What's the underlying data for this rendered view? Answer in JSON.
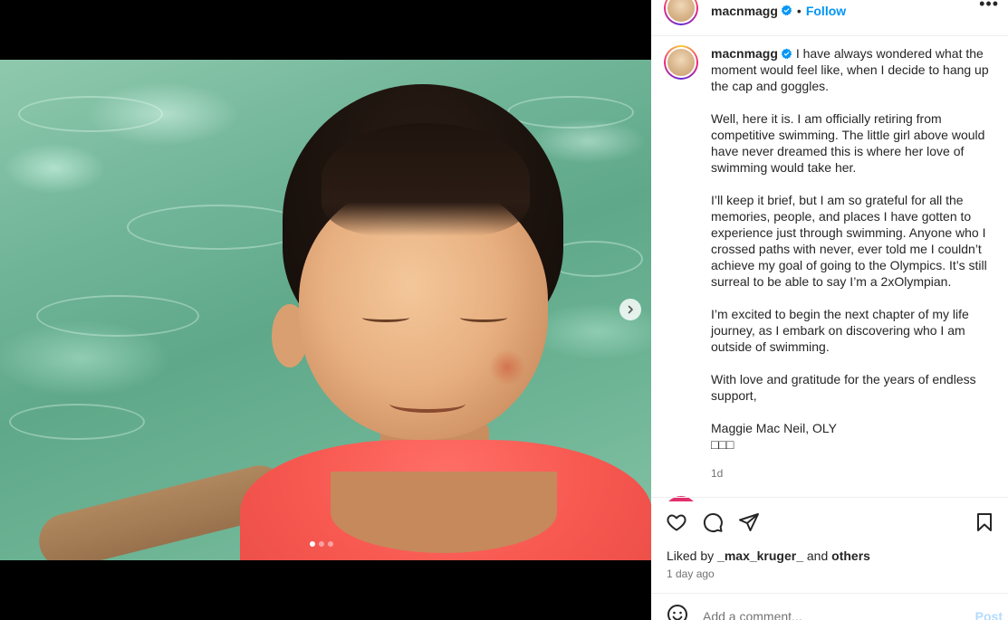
{
  "post": {
    "username": "macnmagg",
    "follow_label": "Follow",
    "separator": "•",
    "more_label": "•••",
    "caption": [
      "I have always wondered what the moment would feel like, when I decide to hang up the cap and goggles.",
      "Well, here it is. I am officially retiring from competitive swimming. The little girl above would have never dreamed this is where her love of swimming would take her.",
      "I’ll keep it brief, but I am so grateful for all the memories, people, and places I have gotten to experience just through swimming. Anyone who I crossed paths with never, ever told me I couldn’t achieve my goal of going to the Olympics. It’s still surreal to be able to say I’m a 2xOlympian.",
      "I’m excited to begin the next chapter of my life journey, as I embark on discovering who I am outside of swimming.",
      "With love and gratitude for the years of endless support,",
      "Maggie Mac Neil, OLY\n□□□"
    ],
    "caption_time": "1d",
    "liked_by_prefix": "Liked by",
    "liked_by_user": "_max_kruger_",
    "liked_by_and": "and",
    "liked_by_others": "others",
    "date": "1 day ago",
    "comment_placeholder": "Add a comment...",
    "post_button": "Post"
  },
  "media": {
    "carousel_dots": 3,
    "active_dot": 0
  },
  "icons": {
    "verified": "verified-badge-icon",
    "like": "heart-icon",
    "comment": "comment-icon",
    "share": "paper-plane-icon",
    "save": "bookmark-icon",
    "emoji": "emoji-icon",
    "next": "chevron-right-icon"
  },
  "colors": {
    "accent": "#0095f6",
    "verified": "#0095f6",
    "muted_text": "#737373",
    "post_disabled": "#b3dbff"
  }
}
